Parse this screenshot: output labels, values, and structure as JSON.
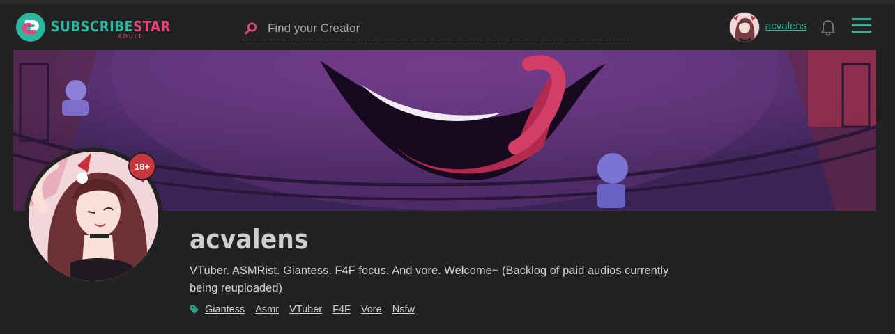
{
  "header": {
    "logo": {
      "main_sub": "SUBSCRIBE",
      "main_star": "STAR",
      "sub": "ADULT"
    },
    "search": {
      "placeholder": "Find your Creator",
      "value": ""
    },
    "user": {
      "name": "acvalens"
    },
    "icons": {
      "search": "search-icon",
      "bell": "bell-icon",
      "menu": "hamburger-menu-icon"
    }
  },
  "profile": {
    "name": "acvalens",
    "age_badge": "18+",
    "bio": "VTuber. ASMRist. Giantess. F4F focus. And vore. Welcome~ (Backlog of paid audios currently being reuploaded)",
    "tags": [
      "Giantess",
      "Asmr",
      "VTuber",
      "F4F",
      "Vore",
      "Nsfw"
    ]
  },
  "colors": {
    "teal": "#2bb79f",
    "pink": "#e4467f",
    "background": "#222222",
    "badge": "#c7383d"
  }
}
